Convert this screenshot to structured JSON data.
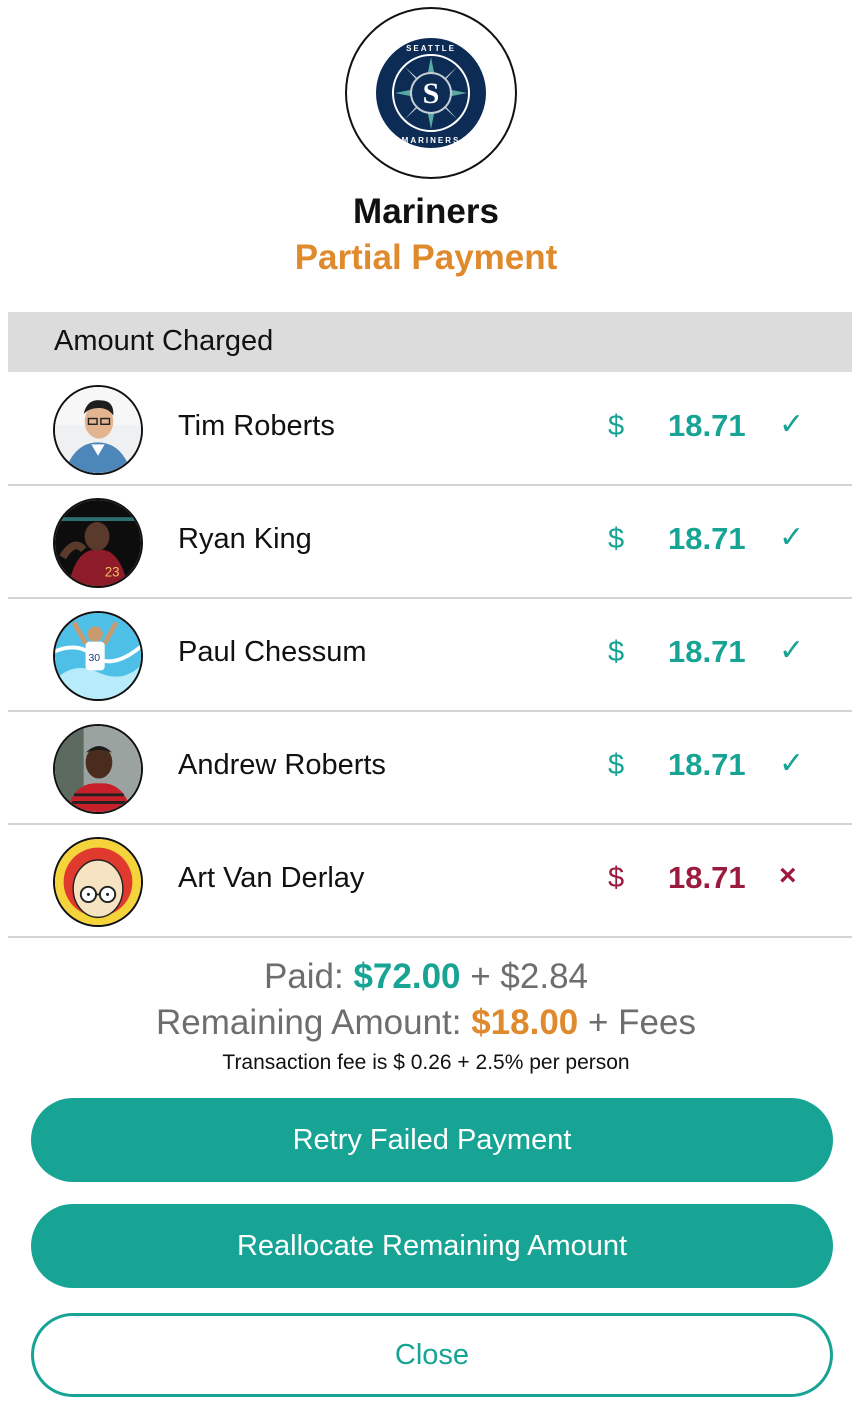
{
  "header": {
    "team_name": "Mariners",
    "status": "Partial Payment",
    "logo": {
      "top_text": "SEATTLE",
      "bottom_text": "MARINERS",
      "letter": "S"
    }
  },
  "section_title": "Amount Charged",
  "payments": [
    {
      "name": "Tim Roberts",
      "currency": "$",
      "amount": "18.71",
      "status": "paid",
      "mark": "✓"
    },
    {
      "name": "Ryan King",
      "currency": "$",
      "amount": "18.71",
      "status": "paid",
      "mark": "✓"
    },
    {
      "name": "Paul Chessum",
      "currency": "$",
      "amount": "18.71",
      "status": "paid",
      "mark": "✓"
    },
    {
      "name": "Andrew Roberts",
      "currency": "$",
      "amount": "18.71",
      "status": "paid",
      "mark": "✓"
    },
    {
      "name": "Art Van Derlay",
      "currency": "$",
      "amount": "18.71",
      "status": "failed",
      "mark": "×"
    }
  ],
  "summary": {
    "paid_label": "Paid: ",
    "paid_amount": "$72.00",
    "paid_fee": " + $2.84",
    "remaining_label": "Remaining Amount: ",
    "remaining_amount": "$18.00",
    "remaining_suffix": " + Fees",
    "fee_note": "Transaction fee is $ 0.26 + 2.5% per person"
  },
  "buttons": {
    "retry": "Retry Failed Payment",
    "reallocate": "Reallocate Remaining Amount",
    "close": "Close"
  },
  "colors": {
    "teal": "#17a495",
    "orange": "#e08a2e",
    "failed": "#9b1b3e",
    "header_bg": "#dcdcdc"
  }
}
